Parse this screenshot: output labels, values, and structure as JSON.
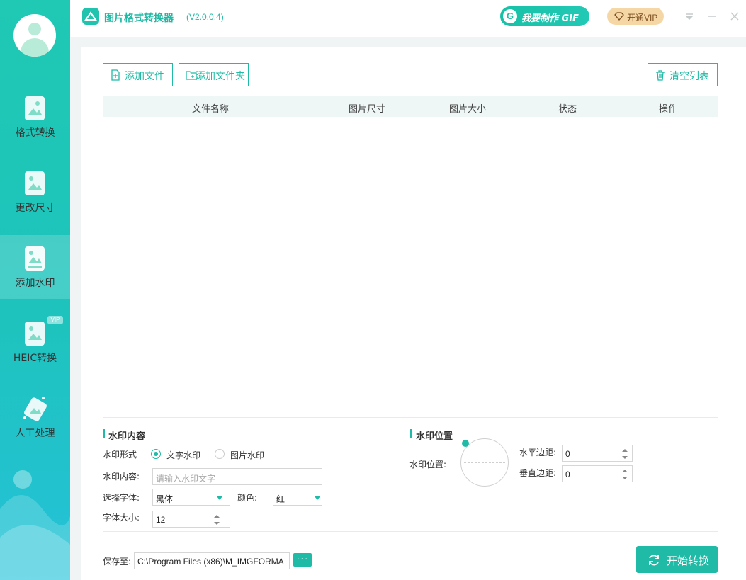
{
  "app": {
    "title": "图片格式转换器",
    "version": "(V2.0.0.4)",
    "gif_button": "我要制作 GIF",
    "vip_button": "开通VIP",
    "accent": "#1fbba6"
  },
  "sidebar": {
    "items": [
      {
        "label": "格式转换",
        "icon": "image-convert-icon",
        "active": false
      },
      {
        "label": "更改尺寸",
        "icon": "image-resize-icon",
        "active": false
      },
      {
        "label": "添加水印",
        "icon": "image-watermark-icon",
        "active": true
      },
      {
        "label": "HEIC转换",
        "icon": "heic-icon",
        "active": false,
        "badge": "VIP"
      },
      {
        "label": "人工处理",
        "icon": "manual-process-icon",
        "active": false
      }
    ]
  },
  "toolbar": {
    "add_file": "添加文件",
    "add_folder": "添加文件夹",
    "clear_list": "清空列表"
  },
  "table": {
    "columns": [
      "文件名称",
      "图片尺寸",
      "图片大小",
      "状态",
      "操作"
    ],
    "rows": []
  },
  "watermark": {
    "content_title": "水印内容",
    "type_label": "水印形式",
    "type_options": [
      "文字水印",
      "图片水印"
    ],
    "type_selected": "文字水印",
    "content_label": "水印内容:",
    "content_placeholder": "请输入水印文字",
    "font_label": "选择字体:",
    "font_value": "黑体",
    "color_label": "颜色:",
    "color_value": "红",
    "size_label": "字体大小:",
    "size_value": "12",
    "position_title": "水印位置",
    "position_label": "水印位置:",
    "h_margin_label": "水平边距:",
    "h_margin_value": "0",
    "v_margin_label": "垂直边距:",
    "v_margin_value": "0"
  },
  "footer": {
    "save_label": "保存至:",
    "save_path": "C:\\Program Files (x86)\\M_IMGFORMA",
    "browse": "···",
    "start_button": "开始转换"
  }
}
